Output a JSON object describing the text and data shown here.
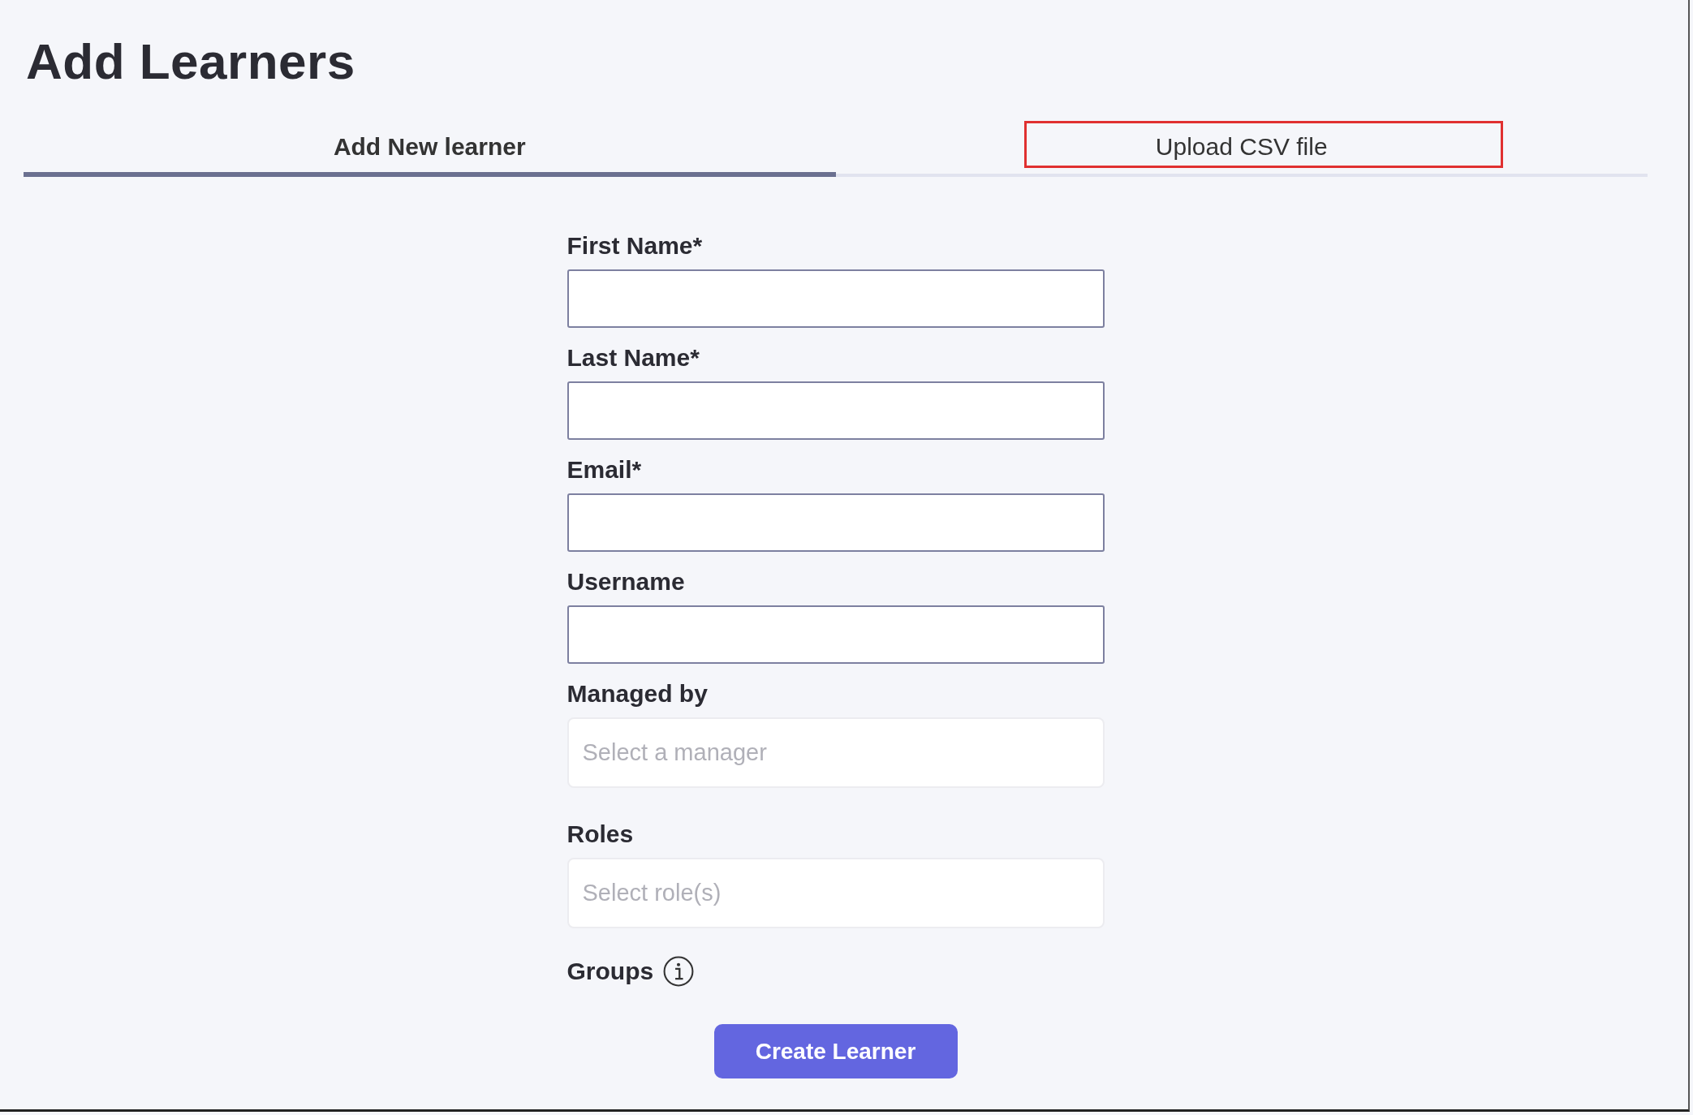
{
  "page": {
    "title": "Add Learners"
  },
  "tabs": [
    {
      "label": "Add New learner",
      "selected": true,
      "highlighted": false
    },
    {
      "label": "Upload CSV file",
      "selected": false,
      "highlighted": true
    }
  ],
  "form": {
    "fields": [
      {
        "kind": "text",
        "label": "First Name*"
      },
      {
        "kind": "text",
        "label": "Last Name*"
      },
      {
        "kind": "text",
        "label": "Email*"
      },
      {
        "kind": "text",
        "label": "Username"
      },
      {
        "kind": "select",
        "label": "Managed by",
        "placeholder": "Select a manager"
      },
      {
        "kind": "select",
        "label": "Roles",
        "placeholder": "Select role(s)"
      },
      {
        "kind": "info",
        "label": "Groups"
      }
    ],
    "submit": "Create Learner"
  }
}
